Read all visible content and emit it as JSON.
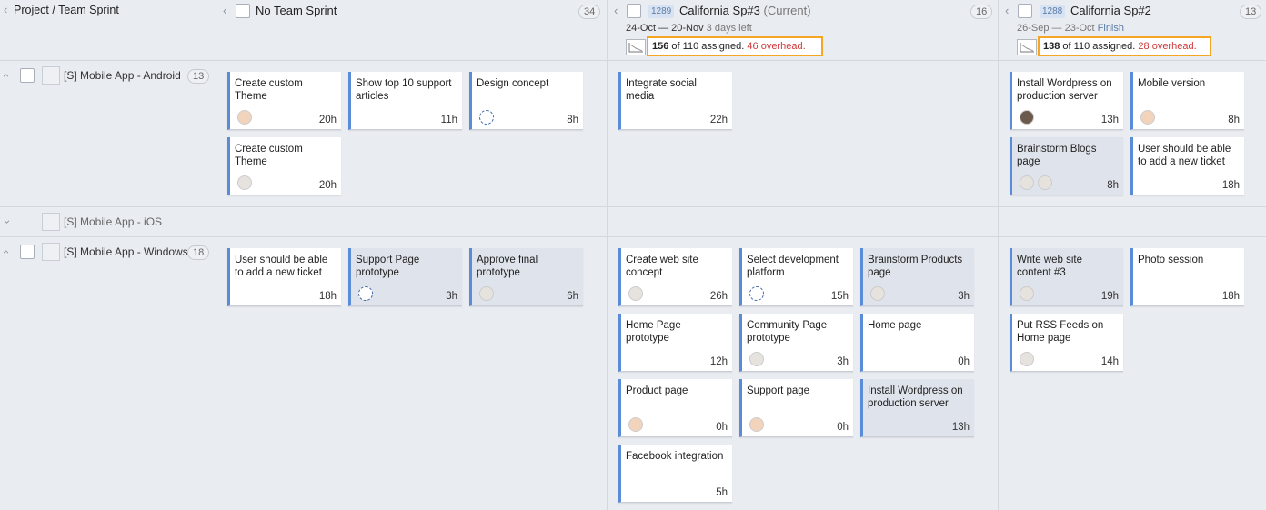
{
  "columns": {
    "project": {
      "title": "Project / Team Sprint"
    },
    "no_sprint": {
      "title": "No Team Sprint",
      "count": "34"
    },
    "sp3": {
      "id": "1289",
      "title": "California Sp#3",
      "suffix": "(Current)",
      "count": "16",
      "dates": "24-Oct — 20-Nov",
      "remaining": "3 days left",
      "assigned": "156",
      "of": "of 110 assigned.",
      "overhead": "46 overhead."
    },
    "sp2": {
      "id": "1288",
      "title": "California Sp#2",
      "count": "13",
      "dates": "26-Sep — 23-Oct",
      "status": "Finish",
      "assigned": "138",
      "of": "of 110 assigned.",
      "overhead": "28 overhead."
    }
  },
  "rows": [
    {
      "title": "[S] Mobile App - Android",
      "count": "13"
    },
    {
      "title": "[S] Mobile App - iOS"
    },
    {
      "title": "[S] Mobile App - Windows",
      "count": "18"
    }
  ],
  "cards": {
    "a1": {
      "title": "Create custom Theme",
      "hours": "20h"
    },
    "a2": {
      "title": "Show top 10 support articles",
      "hours": "11h"
    },
    "a3": {
      "title": "Design concept",
      "hours": "8h"
    },
    "a4": {
      "title": "Create custom Theme",
      "hours": "20h"
    },
    "a5": {
      "title": "Integrate social media",
      "hours": "22h"
    },
    "a6": {
      "title": "Install Wordpress on production server",
      "hours": "13h"
    },
    "a7": {
      "title": "Mobile version",
      "hours": "8h"
    },
    "a8": {
      "title": "Brainstorm Blogs page",
      "hours": "8h"
    },
    "a9": {
      "title": "User should be able to add a new ticket",
      "hours": "18h"
    },
    "w1": {
      "title": "User should be able to add a new ticket",
      "hours": "18h"
    },
    "w2": {
      "title": "Support Page prototype",
      "hours": "3h"
    },
    "w3": {
      "title": "Approve final prototype",
      "hours": "6h"
    },
    "w4": {
      "title": "Create web site concept",
      "hours": "26h"
    },
    "w5": {
      "title": "Select development platform",
      "hours": "15h"
    },
    "w6": {
      "title": "Brainstorm Products page",
      "hours": "3h"
    },
    "w7": {
      "title": "Home Page prototype",
      "hours": "12h"
    },
    "w8": {
      "title": "Community Page prototype",
      "hours": "3h"
    },
    "w9": {
      "title": "Home page",
      "hours": "0h"
    },
    "w10": {
      "title": "Product page",
      "hours": "0h"
    },
    "w11": {
      "title": "Support page",
      "hours": "0h"
    },
    "w12": {
      "title": "Install Wordpress on production server",
      "hours": "13h"
    },
    "w13": {
      "title": "Facebook integration",
      "hours": "5h"
    },
    "w14": {
      "title": "Write web site content #3",
      "hours": "19h"
    },
    "w15": {
      "title": "Photo session",
      "hours": "18h"
    },
    "w16": {
      "title": "Put RSS Feeds on Home page",
      "hours": "14h"
    }
  },
  "colors": {
    "accent": "#5a8cd8",
    "highlight": "#f5a623",
    "overhead": "#d0393b"
  }
}
